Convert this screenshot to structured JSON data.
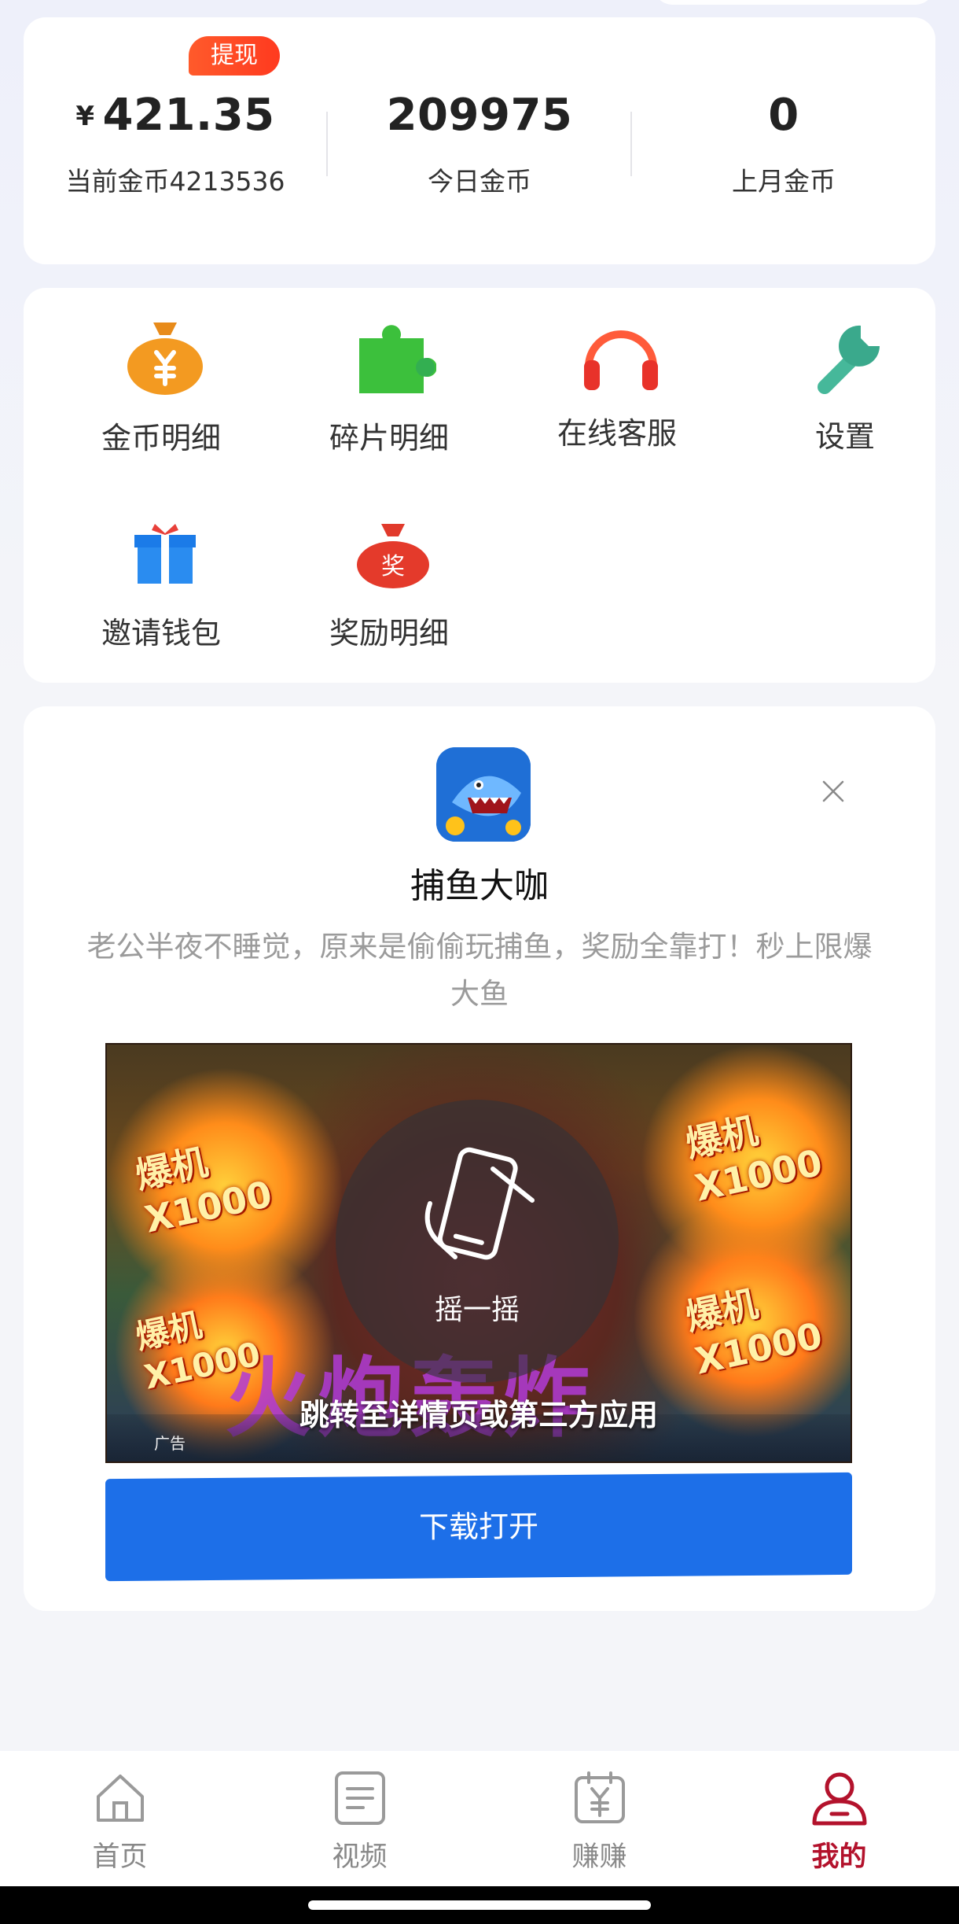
{
  "stats": {
    "withdraw_badge": "提现",
    "currency_symbol": "¥",
    "balance": "421.35",
    "balance_label": "当前金币4213536",
    "today_value": "209975",
    "today_label": "今日金币",
    "last_month_value": "0",
    "last_month_label": "上月金币"
  },
  "functions": [
    {
      "label": "金币明细",
      "icon": "money-bag-icon"
    },
    {
      "label": "碎片明细",
      "icon": "puzzle-icon"
    },
    {
      "label": "在线客服",
      "icon": "headset-icon"
    },
    {
      "label": "设置",
      "icon": "wrench-icon"
    },
    {
      "label": "邀请钱包",
      "icon": "gift-icon"
    },
    {
      "label": "奖励明细",
      "icon": "reward-bag-icon",
      "badge": "奖"
    }
  ],
  "ad": {
    "app_name": "捕鱼大咖",
    "description": "老公半夜不睡觉，原来是偷偷玩捕鱼，奖励全靠打！秒上限爆大鱼",
    "shake_label": "摇一摇",
    "jump_text": "跳转至详情页或第三方应用",
    "ad_tag": "广告",
    "button_label": "下载打开",
    "image_texts": {
      "burst_1": "爆机X1000",
      "burst_2": "爆机X1000",
      "burst_3": "爆机X1000",
      "burst_4": "爆机X1000",
      "banner": "火炮轰炸"
    }
  },
  "nav": {
    "tabs": [
      {
        "label": "首页",
        "icon": "home-icon",
        "active": false
      },
      {
        "label": "视频",
        "icon": "video-doc-icon",
        "active": false
      },
      {
        "label": "赚赚",
        "icon": "earn-icon",
        "active": false
      },
      {
        "label": "我的",
        "icon": "profile-icon",
        "active": true
      }
    ]
  },
  "colors": {
    "accent_blue": "#1d6fe8",
    "active_red": "#b3122c",
    "badge_orange": "#ff4a25"
  }
}
